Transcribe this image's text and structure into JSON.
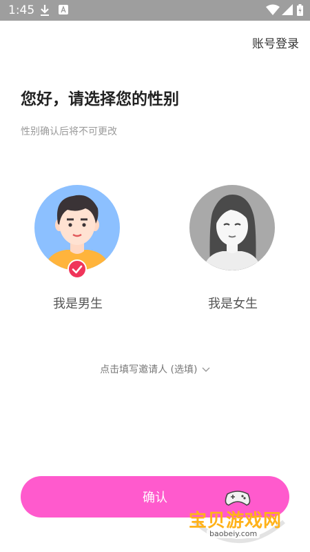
{
  "status_bar": {
    "time": "1:45",
    "icons": [
      "download-icon",
      "a-icon",
      "wifi-icon",
      "signal-icon",
      "battery-icon"
    ]
  },
  "header": {
    "login_link": "账号登录"
  },
  "main": {
    "title": "您好，请选择您的性别",
    "subtitle": "性别确认后将不可更改",
    "options": [
      {
        "label": "我是男生",
        "selected": true
      },
      {
        "label": "我是女生",
        "selected": false
      }
    ],
    "inviter_link": "点击填写邀请人 (选填)",
    "confirm_label": "确认"
  },
  "watermark": {
    "text": "宝贝游戏网",
    "url": "baobeiy.com"
  },
  "colors": {
    "accent": "#ff5acd",
    "check_badge": "#f0355a",
    "status_bar": "#9e9e9e"
  }
}
